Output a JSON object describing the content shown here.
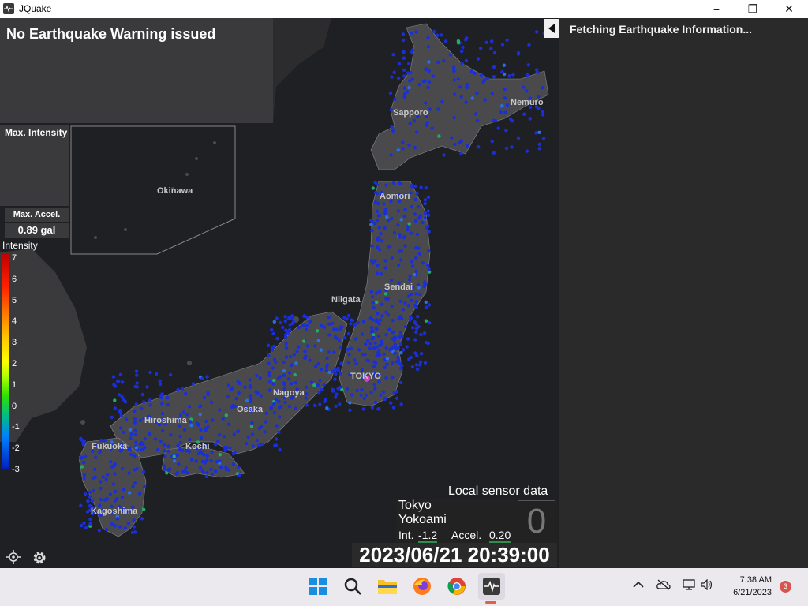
{
  "window": {
    "title": "JQuake",
    "minimize_label": "−",
    "maximize_label": "❐",
    "close_label": "✕"
  },
  "warning": {
    "text": "No Earthquake Warning issued"
  },
  "info_panel": {
    "status": "Fetching Earthquake Information..."
  },
  "max_intensity": {
    "label": "Max. Intensity"
  },
  "max_accel": {
    "label": "Max. Accel.",
    "value": "0.89 gal"
  },
  "legend": {
    "title": "Intensity",
    "ticks": [
      "7",
      "6",
      "5",
      "4",
      "3",
      "2",
      "1",
      "0",
      "-1",
      "-2",
      "-3"
    ]
  },
  "map_labels": {
    "sapporo": "Sapporo",
    "nemuro": "Nemuro",
    "aomori": "Aomori",
    "sendai": "Sendai",
    "niigata": "Niigata",
    "tokyo": "TOKYO",
    "nagoya": "Nagoya",
    "osaka": "Osaka",
    "hiroshima": "Hiroshima",
    "kochi": "Kochi",
    "fukuoka": "Fukuoka",
    "kagoshima": "Kagoshima",
    "okinawa": "Okinawa"
  },
  "sensor": {
    "title": "Local sensor data",
    "city": "Tokyo",
    "station": "Yokoami",
    "int_label": "Int.",
    "int_value": "-1.2",
    "accel_label": "Accel.",
    "accel_value": "0.20",
    "shindo": "0"
  },
  "clock": {
    "datetime": "2023/06/21 20:39:00"
  },
  "taskbar": {
    "time": "7:38 AM",
    "date": "6/21/2023",
    "notifications": "3",
    "apps": [
      "start",
      "search",
      "file-explorer",
      "firefox",
      "chrome",
      "jquake"
    ]
  },
  "colors": {
    "warning_panel": "#3a3a3c",
    "info_panel": "#2a2a2a",
    "map_bg": "#1f2024",
    "land": "#4a4a4c",
    "sensor_dot": "#1a2fd8"
  }
}
